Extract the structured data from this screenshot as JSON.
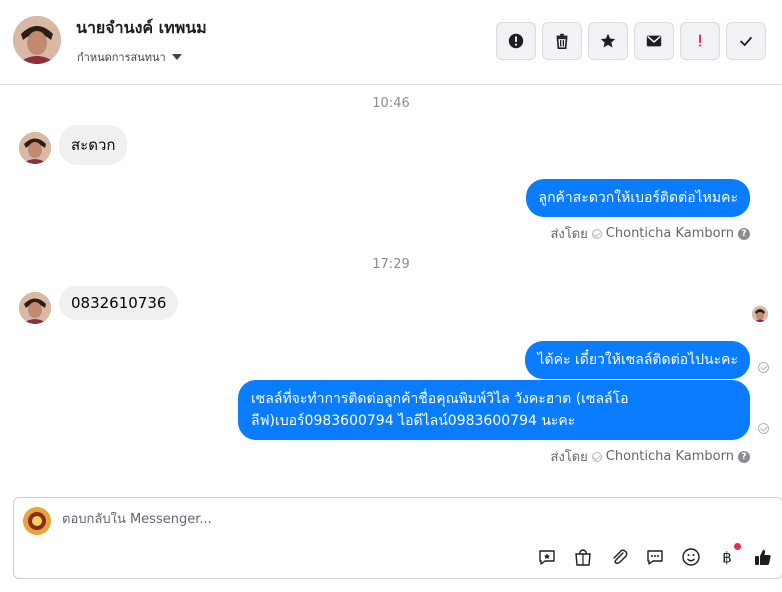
{
  "header": {
    "contact_name": "นายจำนงค์ เทพนม",
    "subtitle": "กำหนดการสนทนา",
    "actions": [
      {
        "name": "spam-button",
        "icon": "alert-circle-icon"
      },
      {
        "name": "delete-button",
        "icon": "trash-icon"
      },
      {
        "name": "star-button",
        "icon": "star-icon"
      },
      {
        "name": "mark-unread-button",
        "icon": "envelope-icon"
      },
      {
        "name": "priority-button",
        "icon": "exclamation-icon"
      },
      {
        "name": "done-button",
        "icon": "check-icon"
      }
    ]
  },
  "thread": {
    "time1": "10:46",
    "msg_in_1": "สะดวก",
    "msg_out_1": "ลูกค้าสะดวกให้เบอร์ติดต่อไหมคะ",
    "sent_by_1_prefix": "ส่งโดย",
    "sent_by_1_name": "Chonticha Kamborn",
    "time2": "17:29",
    "msg_in_2": "0832610736",
    "msg_out_2": "ได้ค่ะ เดี๋ยวให้เซลล์ติดต่อไปนะคะ",
    "msg_out_3": "เซลล์ที่จะทำการติดต่อลูกค้าชื่อคุณพิมพ์วิไล วังคะฮาต (เซลล์โอลีฟ)เบอร์0983600794 ไอดีไลน์0983600794 นะคะ",
    "sent_by_2_prefix": "ส่งโดย",
    "sent_by_2_name": "Chonticha Kamborn"
  },
  "composer": {
    "placeholder": "ตอบกลับใน Messenger...",
    "tools": [
      "saved-reply-icon",
      "shopping-bag-icon",
      "paperclip-icon",
      "chat-bubble-icon",
      "emoji-icon",
      "baht-icon",
      "thumbs-up-icon"
    ]
  },
  "colors": {
    "accent": "#0a7cff",
    "incoming_bg": "#f0f0f0",
    "notification": "#f02849"
  }
}
